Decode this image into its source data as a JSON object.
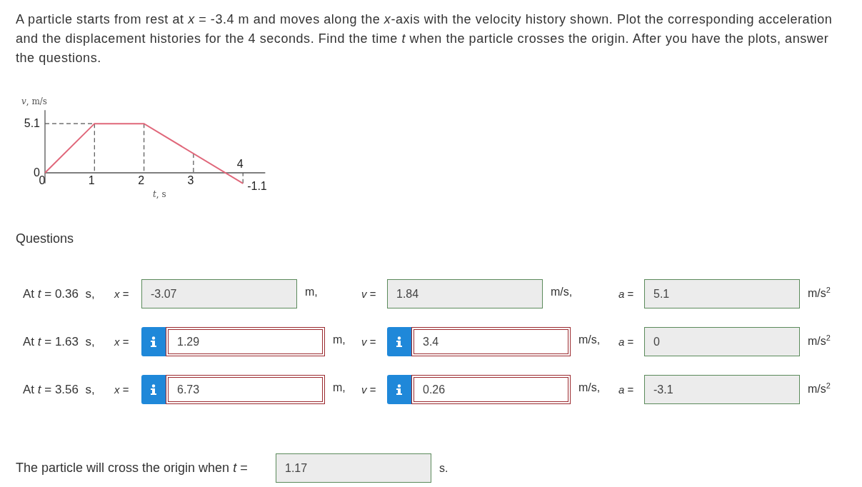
{
  "problem": {
    "text": "A particle starts from rest at *x* = -3.4 m and moves along the *x*-axis with the velocity history shown. Plot the corresponding acceleration and the displacement histories for the 4 seconds. Find the time *t* when the particle crosses the origin. After you have the plots, answer the questions."
  },
  "graph": {
    "chart_data": {
      "type": "line",
      "ylabel": "*v*, m/s",
      "xlabel": "*t*, s",
      "x": [
        0,
        1,
        2,
        4
      ],
      "series": [
        {
          "color": "#e0677a",
          "values": [
            0,
            5.1,
            5.1,
            -1.1
          ]
        }
      ],
      "xlim": [
        0,
        4.45
      ],
      "ylim": [
        -1.1,
        6.5
      ],
      "xticks": [
        0,
        1,
        2,
        3
      ],
      "yticks": [
        0,
        5.1
      ],
      "value_labels": [
        null,
        null,
        null,
        "-1.1"
      ],
      "annotations": [
        "4"
      ],
      "ref_lines": [
        {
          "axis": "y",
          "value": 5.1
        },
        {
          "axis": "x",
          "value": 1
        },
        {
          "axis": "x",
          "value": 2
        },
        {
          "axis": "x",
          "value": 3
        },
        {
          "axis": "x",
          "value": 4
        }
      ]
    }
  },
  "questions_heading": "Questions",
  "questions": [
    {
      "prompt": "At *t* = 0.36  s,",
      "answers": [
        {
          "label": "*x* =",
          "value": "-3.07",
          "unit": "m,",
          "flagged": false
        },
        {
          "label": "*v* =",
          "value": "1.84",
          "unit": "m/s,",
          "flagged": false
        },
        {
          "label": "*a* =",
          "value": "5.1",
          "unit": "m/s$^{2}$",
          "flagged": false
        }
      ]
    },
    {
      "prompt": "At *t* = 1.63  s,",
      "answers": [
        {
          "label": "*x* =",
          "value": "1.29",
          "unit": "m,",
          "flagged": true
        },
        {
          "label": "*v* =",
          "value": "3.4",
          "unit": "m/s,",
          "flagged": true
        },
        {
          "label": "*a* =",
          "value": "0",
          "unit": "m/s$^{2}$",
          "flagged": false
        }
      ]
    },
    {
      "prompt": "At *t* = 3.56  s,",
      "answers": [
        {
          "label": "*x* =",
          "value": "6.73",
          "unit": "m,",
          "flagged": true
        },
        {
          "label": "*v* =",
          "value": "0.26",
          "unit": "m/s,",
          "flagged": true
        },
        {
          "label": "*a* =",
          "value": "-3.1",
          "unit": "m/s$^{2}$",
          "flagged": false
        }
      ]
    }
  ],
  "final": {
    "prompt": "The particle will cross the origin when *t* =",
    "value": "1.17",
    "unit": "s.",
    "flagged": false
  }
}
